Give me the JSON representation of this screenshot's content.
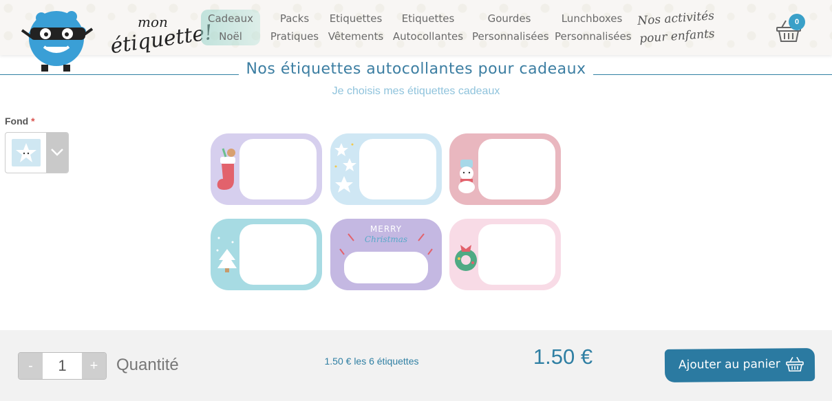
{
  "brand": {
    "logo_line1": "mon",
    "logo_line2": "étiquette!"
  },
  "nav": {
    "items": [
      {
        "line1": "Cadeaux",
        "line2": "Noël"
      },
      {
        "line1": "Packs",
        "line2": "Pratiques"
      },
      {
        "line1": "Etiquettes",
        "line2": "Vêtements"
      },
      {
        "line1": "Etiquettes",
        "line2": "Autocollantes"
      },
      {
        "line1": "Gourdes",
        "line2": "Personnalisées"
      },
      {
        "line1": "Lunchboxes",
        "line2": "Personnalisées"
      },
      {
        "line1": "Nos activités",
        "line2": "pour enfants"
      }
    ]
  },
  "cart": {
    "count": "0"
  },
  "page": {
    "title": "Nos étiquettes autocollantes pour cadeaux",
    "subtitle": "Je choisis mes étiquettes cadeaux"
  },
  "options": {
    "fond_label": "Fond",
    "required_mark": "*"
  },
  "labels": {
    "tile5_line1": "MERRY",
    "tile5_line2": "Christmas"
  },
  "colors": {
    "accent": "#2f7fa3",
    "tile1": "#d6cfee",
    "tile2": "#cfe7f4",
    "tile3": "#e9b7bf",
    "tile4": "#a7dbe3",
    "tile5": "#c4b8e2",
    "tile6": "#f8dbe6"
  },
  "purchase": {
    "minus": "-",
    "plus": "+",
    "quantity": "1",
    "quantity_label": "Quantité",
    "unit_price": "1.50 € les 6 étiquettes",
    "total": "1.50 €",
    "add_to_cart": "Ajouter au panier"
  }
}
